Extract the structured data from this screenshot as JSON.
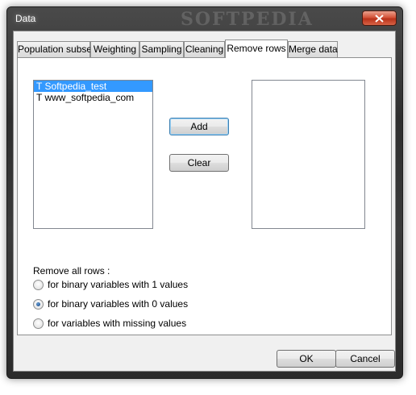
{
  "window": {
    "title": "Data",
    "watermark": "SOFTPEDIA"
  },
  "tabs": [
    {
      "label": "Population subset"
    },
    {
      "label": "Weighting"
    },
    {
      "label": "Sampling"
    },
    {
      "label": "Cleaning"
    },
    {
      "label": "Remove rows",
      "active": true
    },
    {
      "label": "Merge data"
    }
  ],
  "left_list": {
    "items": [
      {
        "label": "T Softpedia_test",
        "selected": true
      },
      {
        "label": "T www_softpedia_com",
        "selected": false
      }
    ]
  },
  "right_list": {
    "items": []
  },
  "buttons": {
    "add": "Add",
    "clear": "Clear",
    "ok": "OK",
    "cancel": "Cancel"
  },
  "remove_section": {
    "label": "Remove all rows :",
    "options": [
      {
        "label": "for binary variables with 1 values",
        "checked": false
      },
      {
        "label": "for binary variables with 0 values",
        "checked": true
      },
      {
        "label": "for variables with missing values",
        "checked": false
      }
    ]
  },
  "colors": {
    "selection": "#3399ff",
    "close_button": "#d4543a"
  },
  "icons": {
    "close": "close-icon",
    "radio": "radio-button"
  }
}
